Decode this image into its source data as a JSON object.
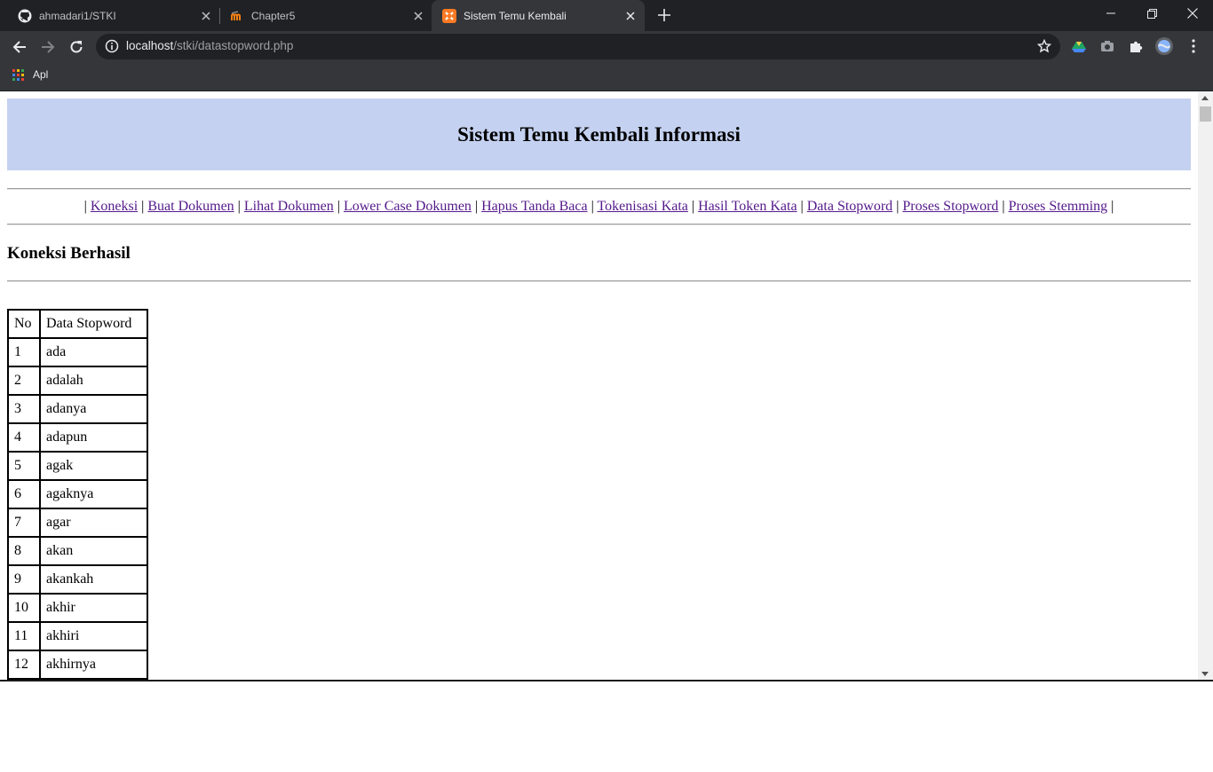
{
  "browser": {
    "tabs": [
      {
        "title": "ahmadari1/STKI",
        "favicon": "github-icon",
        "active": false
      },
      {
        "title": "Chapter5",
        "favicon": "moodle-icon",
        "active": false
      },
      {
        "title": "Sistem Temu Kembali",
        "favicon": "xampp-icon",
        "active": true
      }
    ],
    "url_host": "localhost",
    "url_path": "/stki/datastopword.php",
    "bookmark_label": "Apl",
    "colors": {
      "frame": "#202124",
      "toolbar": "#35363a",
      "omnibox": "#202124"
    }
  },
  "page": {
    "title": "Sistem Temu Kembali Informasi",
    "nav_links": [
      "Koneksi",
      "Buat Dokumen",
      "Lihat Dokumen",
      "Lower Case Dokumen",
      "Hapus Tanda Baca",
      "Tokenisasi Kata",
      "Hasil Token Kata",
      "Data Stopword",
      "Proses Stopword",
      "Proses Stemming"
    ],
    "status": "Koneksi Berhasil",
    "table": {
      "headers": [
        "No",
        "Data Stopword"
      ],
      "rows": [
        [
          "1",
          "ada"
        ],
        [
          "2",
          "adalah"
        ],
        [
          "3",
          "adanya"
        ],
        [
          "4",
          "adapun"
        ],
        [
          "5",
          "agak"
        ],
        [
          "6",
          "agaknya"
        ],
        [
          "7",
          "agar"
        ],
        [
          "8",
          "akan"
        ],
        [
          "9",
          "akankah"
        ],
        [
          "10",
          "akhir"
        ],
        [
          "11",
          "akhiri"
        ],
        [
          "12",
          "akhirnya"
        ],
        [
          "",
          ""
        ]
      ]
    },
    "colors": {
      "banner": "#c5d1f0",
      "link": "#551a8b"
    }
  }
}
